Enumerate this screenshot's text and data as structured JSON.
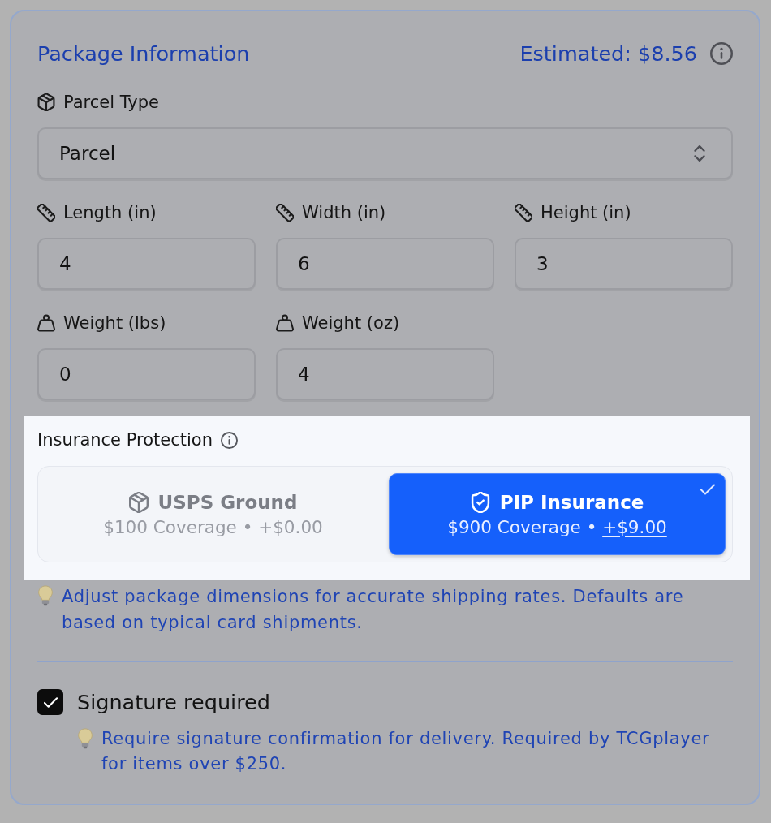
{
  "header": {
    "title": "Package Information",
    "estimate": "Estimated: $8.56"
  },
  "parcel_type": {
    "label": "Parcel Type",
    "value": "Parcel"
  },
  "measurements": [
    {
      "kind": "length",
      "label": "Length (in)",
      "value": "4"
    },
    {
      "kind": "length",
      "label": "Width (in)",
      "value": "6"
    },
    {
      "kind": "length",
      "label": "Height (in)",
      "value": "3"
    },
    {
      "kind": "weight",
      "label": "Weight (lbs)",
      "value": "0"
    },
    {
      "kind": "weight",
      "label": "Weight (oz)",
      "value": "4"
    }
  ],
  "insurance": {
    "label": "Insurance Protection",
    "highlighted": true,
    "options": [
      {
        "kind": "box",
        "title": "USPS Ground",
        "coverage": "$100 Coverage",
        "separator": "•",
        "price": "+$0.00",
        "selected": false
      },
      {
        "kind": "shield",
        "title": "PIP Insurance",
        "coverage": "$900 Coverage",
        "separator": "•",
        "price": "+$9.00",
        "selected": true
      }
    ]
  },
  "dimension_hint": "Adjust package dimensions for accurate shipping rates. Defaults are based on typical card shipments.",
  "signature": {
    "label": "Signature required",
    "checked": true,
    "hint": "Require signature confirmation for delivery. Required by TCGplayer for items over $250."
  }
}
